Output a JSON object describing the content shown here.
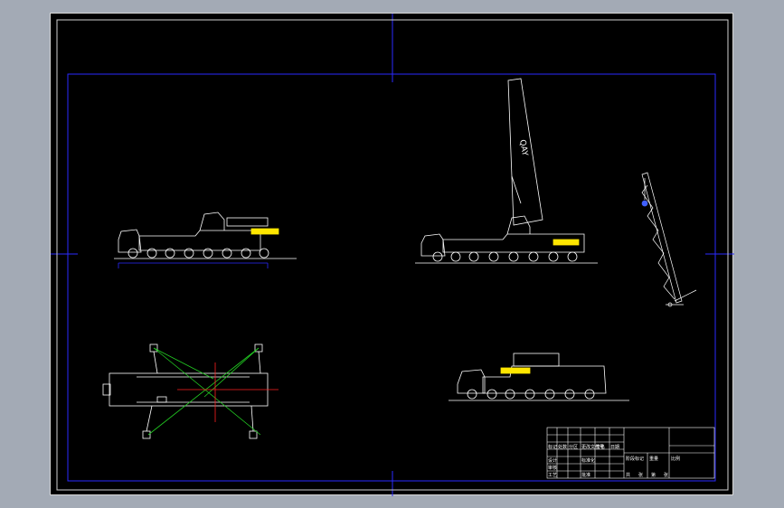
{
  "colors": {
    "background": "#a3aab5",
    "sheet": "#000000",
    "frame_blue": "#2a2aff",
    "line_white": "#ffffff",
    "accent_yellow": "#ffe600",
    "outrigger_green": "#22cc22",
    "center_red": "#ff2020",
    "hook_blue": "#4060ff"
  },
  "boom_label": "QAY",
  "title_block": {
    "row1": [
      "标记",
      "处数",
      "分区",
      "更改文件号",
      "签名",
      "日期"
    ],
    "left": [
      "设计",
      "审核",
      "工艺"
    ],
    "mid": [
      "标准化",
      "批准"
    ],
    "right_headers": [
      "阶段标记",
      "重量",
      "比例"
    ],
    "sheet_info": [
      "共",
      "张",
      "第",
      "张"
    ]
  },
  "views": [
    {
      "name": "front-view"
    },
    {
      "name": "working-view"
    },
    {
      "name": "boom-lifting-view"
    },
    {
      "name": "top-view"
    },
    {
      "name": "rear-view"
    }
  ]
}
